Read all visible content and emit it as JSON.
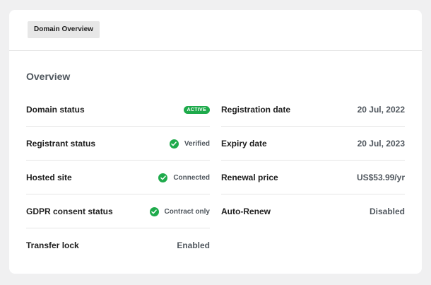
{
  "header": {
    "tab_label": "Domain Overview"
  },
  "section": {
    "title": "Overview"
  },
  "left_rows": [
    {
      "label": "Domain status",
      "value": "ACTIVE"
    },
    {
      "label": "Registrant status",
      "value": "Verified"
    },
    {
      "label": "Hosted site",
      "value": "Connected"
    },
    {
      "label": "GDPR consent status",
      "value": "Contract only"
    },
    {
      "label": "Transfer lock",
      "value": "Enabled"
    }
  ],
  "right_rows": [
    {
      "label": "Registration date",
      "value": "20 Jul, 2022"
    },
    {
      "label": "Expiry date",
      "value": "20 Jul, 2023"
    },
    {
      "label": "Renewal price",
      "value": "US$53.99/yr"
    },
    {
      "label": "Auto-Renew",
      "value": "Disabled"
    }
  ],
  "colors": {
    "success": "#1eaa4b",
    "muted_text": "#50575e",
    "background": "#f0f0f1"
  },
  "icons": {
    "status_check": "check-circle-icon"
  }
}
